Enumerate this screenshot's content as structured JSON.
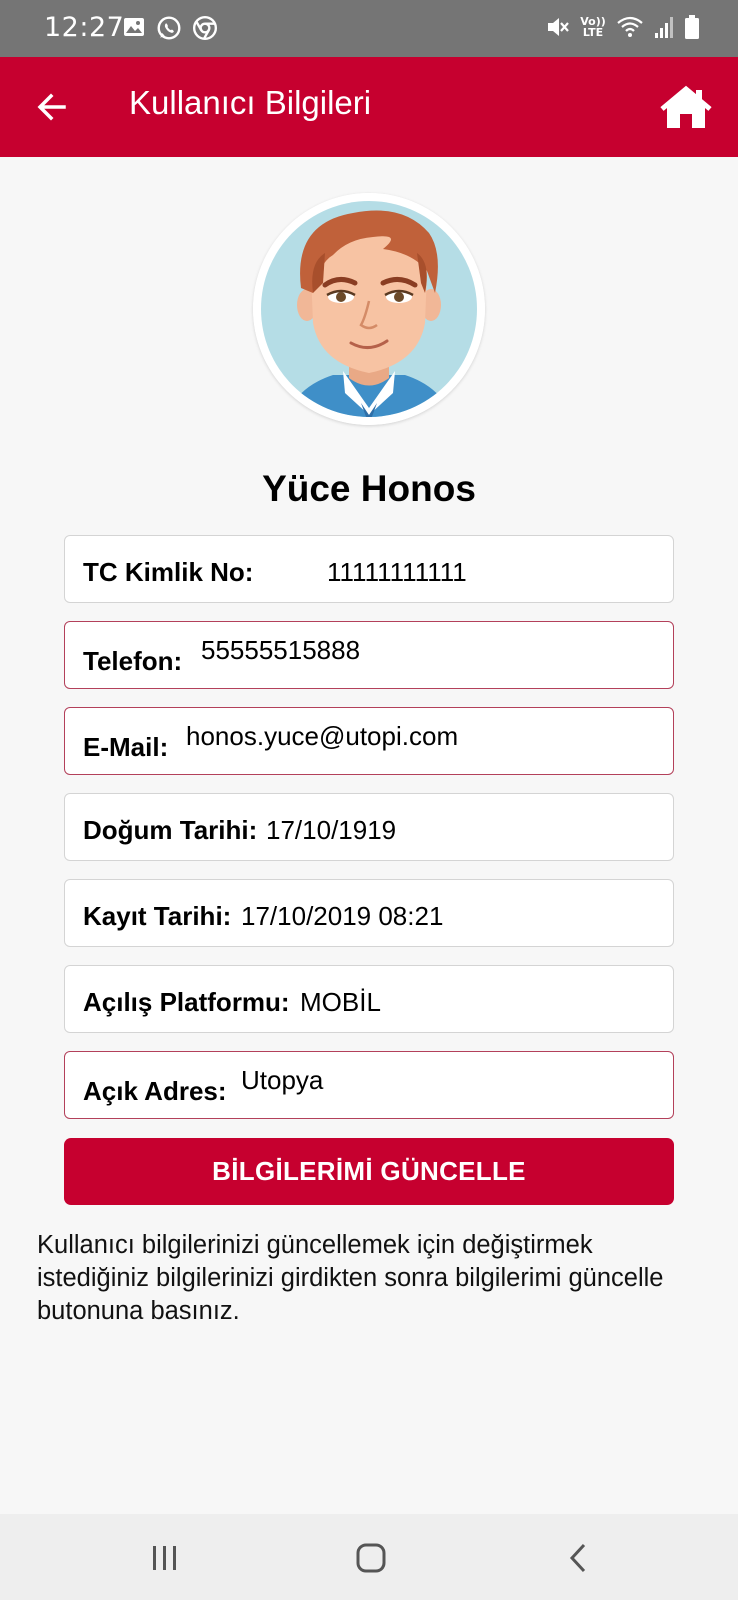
{
  "status_bar": {
    "time": "12:27",
    "left_icons": [
      "gallery-icon",
      "whatsapp-icon",
      "chrome-icon"
    ],
    "right_icons": [
      "mute-icon",
      "volte-icon",
      "wifi-icon",
      "signal-icon",
      "battery-icon"
    ],
    "volte_label": "Vo)) LTE"
  },
  "app_bar": {
    "title": "Kullanıcı Bilgileri",
    "back_icon": "arrow-left-icon",
    "home_icon": "home-icon",
    "color": "#c6002f"
  },
  "profile": {
    "name": "Yüce Honos"
  },
  "fields": [
    {
      "label": "TC Kimlik No:",
      "value": "11111111111",
      "editable": false
    },
    {
      "label": "Telefon:",
      "value": "55555515888",
      "editable": true
    },
    {
      "label": "E-Mail:",
      "value": "honos.yuce@utopi.com",
      "editable": true
    },
    {
      "label": "Doğum Tarihi:",
      "value": "17/10/1919",
      "editable": false
    },
    {
      "label": "Kayıt Tarihi:",
      "value": "17/10/2019 08:21",
      "editable": false
    },
    {
      "label": "Açılış Platformu:",
      "value": "MOBİL",
      "editable": false
    },
    {
      "label": "Açık Adres:",
      "value": "Utopya",
      "editable": true
    }
  ],
  "update_button": {
    "label": "BİLGİLERİMİ GÜNCELLE"
  },
  "info_text": "Kullanıcı bilgilerinizi güncellemek için değiştirmek istediğiniz bilgilerinizi girdikten sonra bilgilerimi güncelle butonuna basınız.",
  "nav_bar": {
    "icons": [
      "recent-apps-icon",
      "home-nav-icon",
      "back-nav-icon"
    ]
  }
}
